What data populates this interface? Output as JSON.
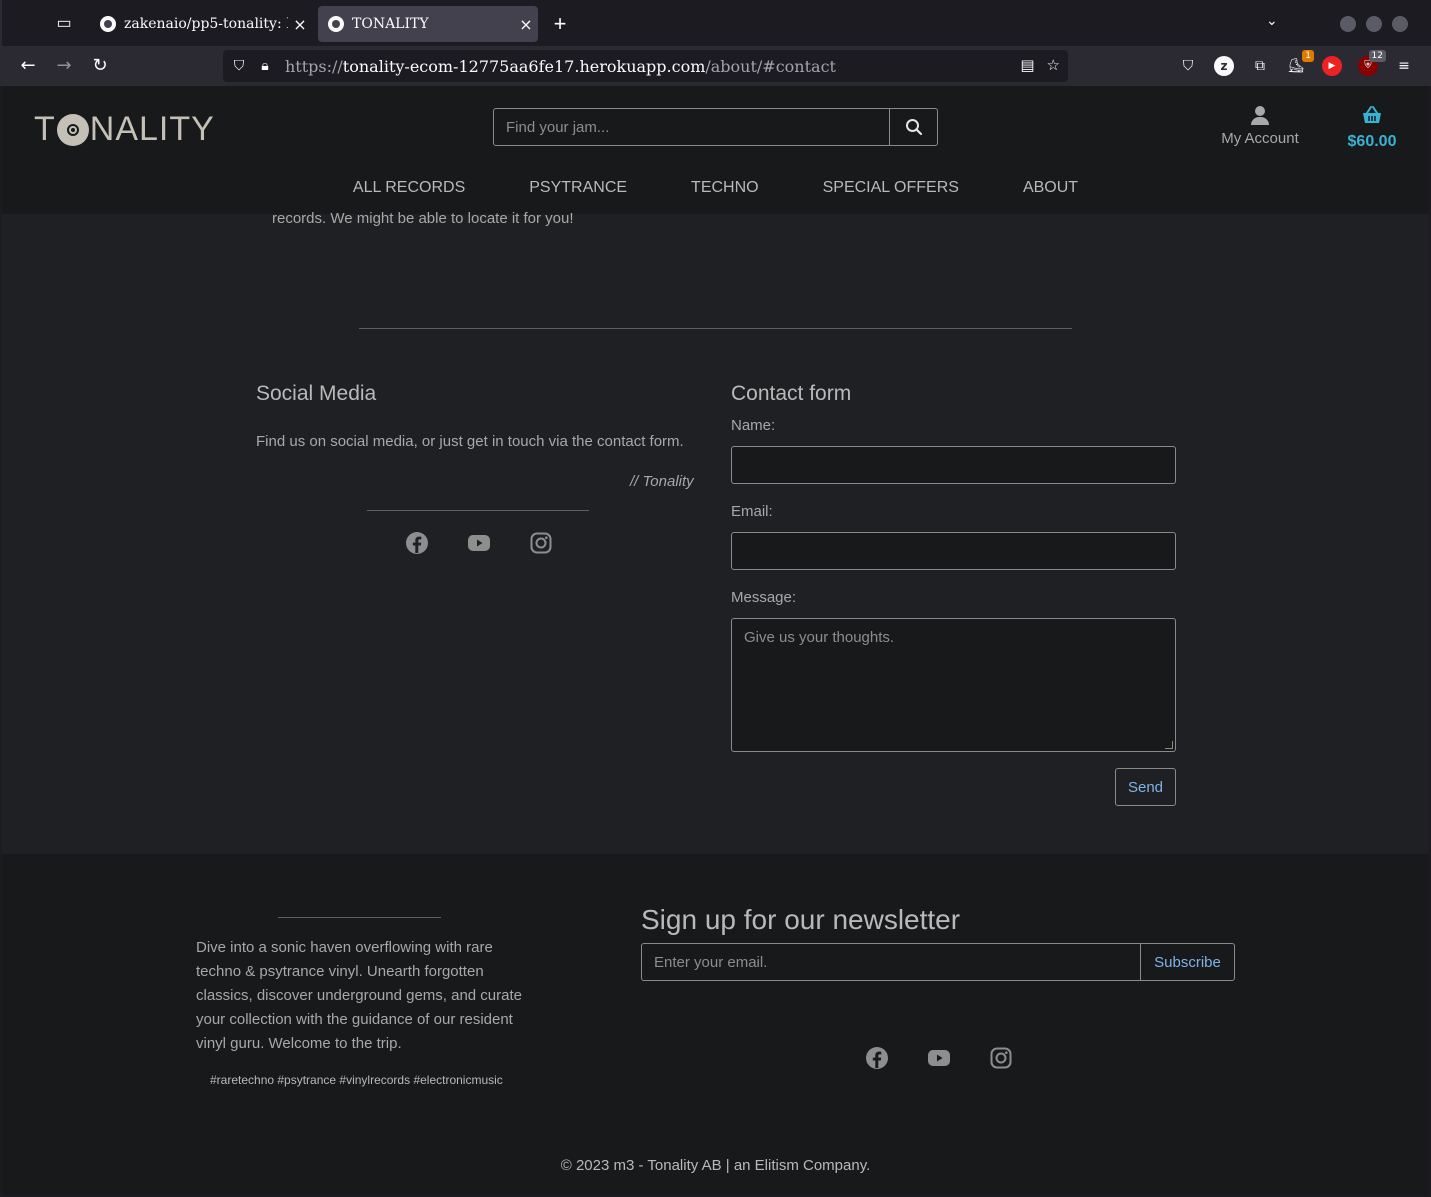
{
  "browser": {
    "tabs": [
      {
        "title": "zakenaio/pp5-tonality: I",
        "close": "×"
      },
      {
        "title": "TONALITY",
        "close": "×"
      }
    ],
    "url_scheme": "https://",
    "url_host": "tonality-ecom-12775aa6fe17.herokuapp.com",
    "url_path": "/about/#contact",
    "extension_badges": {
      "ext1": "1",
      "ext2": "12"
    }
  },
  "site": {
    "logo": {
      "left": "T",
      "right": "NALITY"
    },
    "search_placeholder": "Find your jam...",
    "account_label": "My Account",
    "cart_total": "$60.00",
    "nav": [
      "ALL RECORDS",
      "PSYTRANCE",
      "TECHNO",
      "SPECIAL OFFERS",
      "ABOUT"
    ],
    "intro_tail": "records. We might be able to locate it for you!"
  },
  "social": {
    "heading": "Social Media",
    "text": "Find us on social media, or just get in touch via the contact form.",
    "signature": "// Tonality"
  },
  "contact": {
    "heading": "Contact form",
    "name_label": "Name:",
    "email_label": "Email:",
    "message_label": "Message:",
    "message_placeholder": "Give us your thoughts.",
    "send_label": "Send"
  },
  "footer": {
    "blurb": "Dive into a sonic haven overflowing with rare techno & psytrance vinyl. Unearth forgotten classics, discover underground gems, and curate your collection with the guidance of our resident vinyl guru. Welcome to the trip.",
    "hashtags": "#raretechno #psytrance #vinylrecords #electronicmusic",
    "newsletter_title": "Sign up for our newsletter",
    "email_placeholder": "Enter your email.",
    "subscribe_label": "Subscribe",
    "copyright": "© 2023 m3 - Tonality AB | an Elitism Company."
  },
  "colors": {
    "accent": "#39b3d3",
    "link": "#7fb3e8",
    "background": "#1f2023"
  }
}
